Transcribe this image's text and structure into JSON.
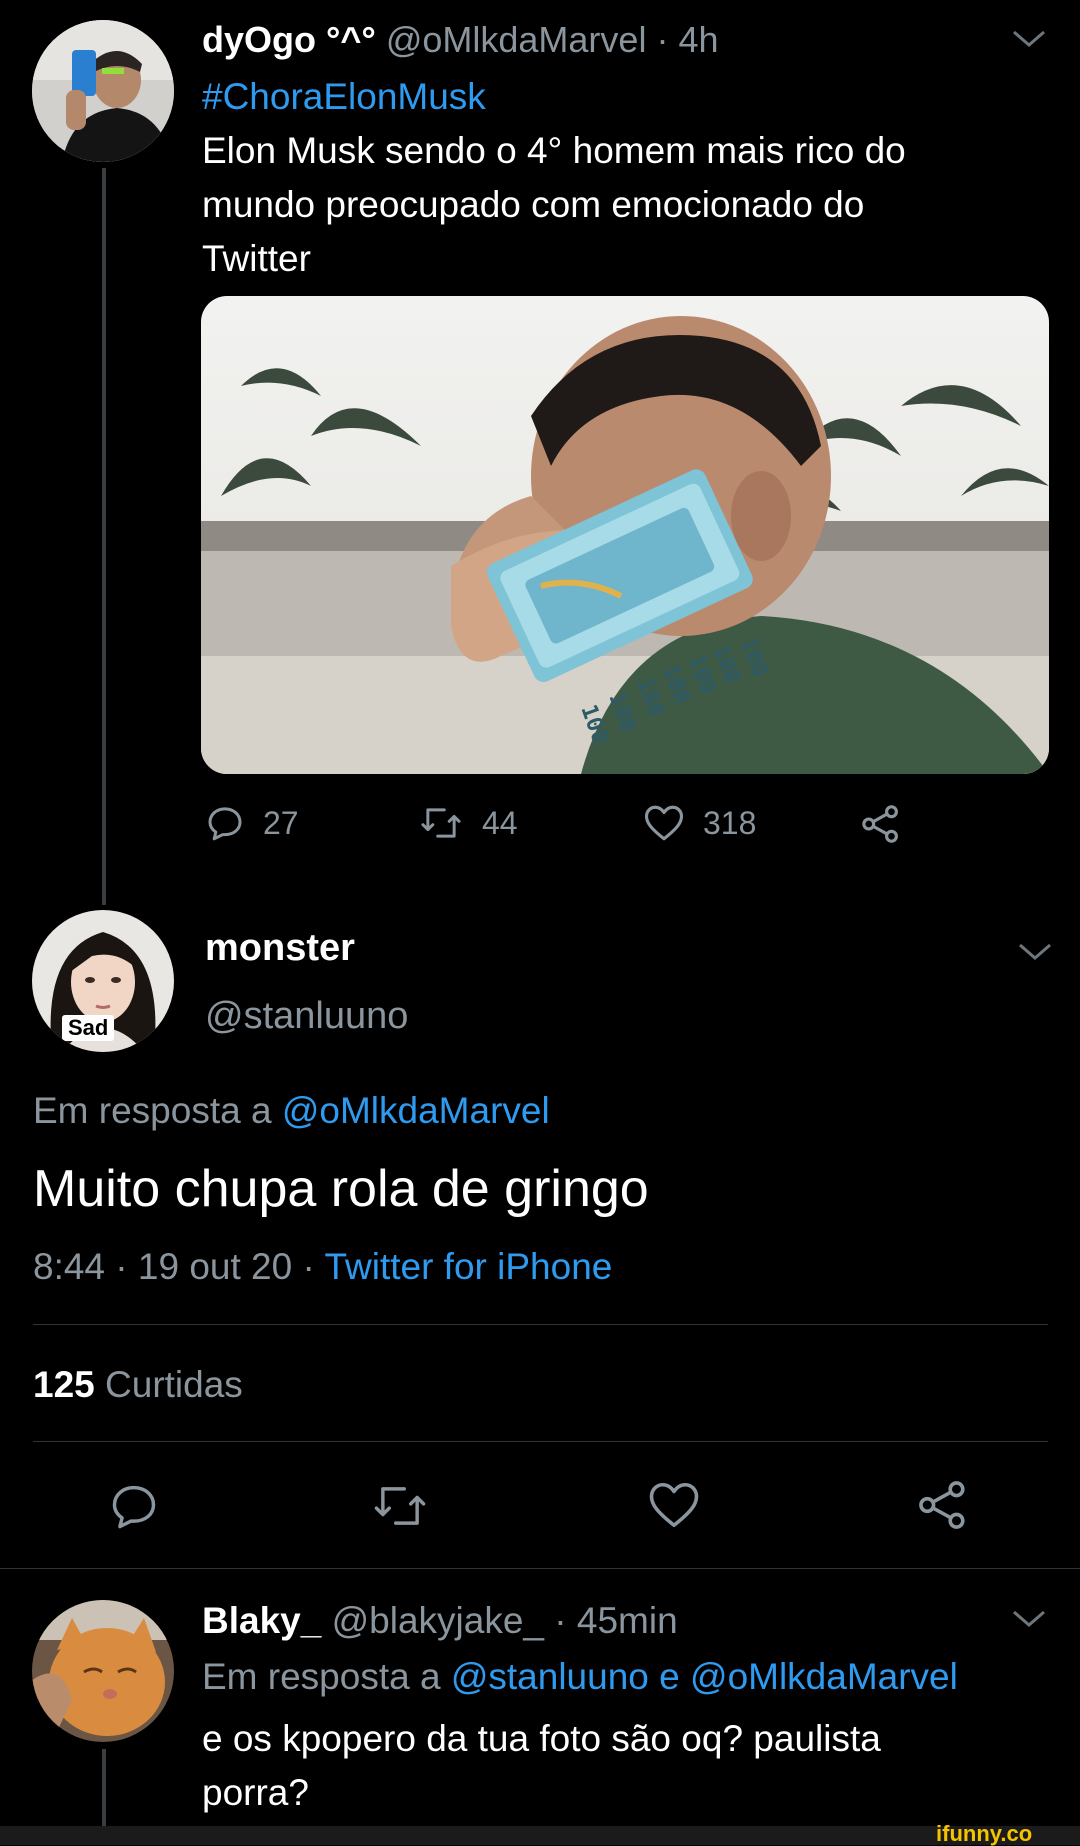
{
  "tweet1": {
    "name": "dyOgo °^°",
    "handle": "@oMlkdaMarvel",
    "time": "· 4h",
    "hashtag": "#ChoraElonMusk",
    "text_line1": "Elon Musk sendo o 4° homem mais rico do",
    "text_line2": "mundo preocupado com emocionado do",
    "text_line3": "Twitter",
    "image_text": "100",
    "actions": {
      "replies": "27",
      "retweets": "44",
      "likes": "318"
    }
  },
  "tweet2": {
    "name": "monster",
    "handle": "@stanluuno",
    "avatar_badge": "Sad",
    "reply_prefix": "Em resposta a",
    "reply_to": "@oMlkdaMarvel",
    "text": "Muito chupa rola de gringo",
    "timestamp": "8:44 · 19 out 20 ·",
    "client": "Twitter for iPhone",
    "likes_count": "125",
    "likes_label": "Curtidas"
  },
  "tweet3": {
    "name": "Blaky_",
    "handle": "@blakyjake_",
    "time": "· 45min",
    "reply_prefix": "Em resposta a",
    "reply_to": "@stanluuno e @oMlkdaMarvel",
    "text_line1": "e os kpopero da tua foto são oq? paulista",
    "text_line2": "porra?"
  },
  "watermark": "ifunny.co",
  "colors": {
    "background": "#000000",
    "link": "#2f9bf0",
    "muted": "#8b959e",
    "divider": "#2f3336",
    "watermark": "#f4c400"
  },
  "icons": [
    "chevron-down-icon",
    "reply-icon",
    "retweet-icon",
    "like-icon",
    "share-icon"
  ]
}
